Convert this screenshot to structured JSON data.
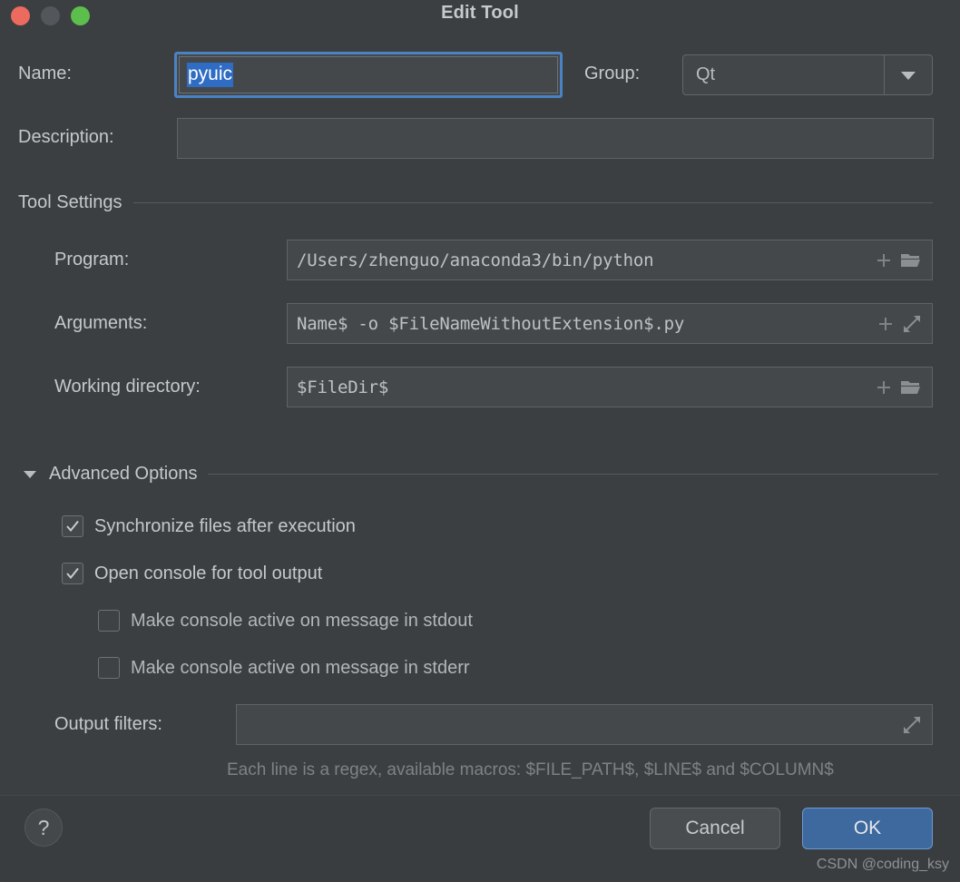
{
  "window": {
    "title": "Edit Tool",
    "traffic_lights": [
      {
        "name": "close",
        "color": "#ec6a5e"
      },
      {
        "name": "minimize",
        "color": "#53575b"
      },
      {
        "name": "zoom",
        "color": "#5cbe4d"
      }
    ]
  },
  "form": {
    "name_label": "Name:",
    "name_value": "pyuic",
    "group_label": "Group:",
    "group_value": "Qt",
    "description_label": "Description:",
    "description_value": "",
    "description_placeholder": ""
  },
  "tool_settings": {
    "section_title": "Tool Settings",
    "program_label": "Program:",
    "program_value": "/Users/zhenguo/anaconda3/bin/python",
    "arguments_label": "Arguments:",
    "arguments_value": "Name$ -o $FileNameWithoutExtension$.py",
    "working_directory_label": "Working directory:",
    "working_directory_value": "$FileDir$"
  },
  "advanced": {
    "section_title": "Advanced Options",
    "checkboxes": [
      {
        "label": "Synchronize files after execution",
        "checked": true,
        "indent": 0
      },
      {
        "label": "Open console for tool output",
        "checked": true,
        "indent": 0
      },
      {
        "label": "Make console active on message in stdout",
        "checked": false,
        "indent": 1
      },
      {
        "label": "Make console active on message in stderr",
        "checked": false,
        "indent": 1
      }
    ],
    "output_filters_label": "Output filters:",
    "output_filters_value": "",
    "hint": "Each line is a regex, available macros: $FILE_PATH$, $LINE$ and $COLUMN$"
  },
  "footer": {
    "help_label": "?",
    "cancel_label": "Cancel",
    "ok_label": "OK",
    "watermark": "CSDN @coding_ksy",
    "ok_color": "#3d699f"
  },
  "icons": {
    "plus": "plus-icon",
    "folder": "folder-icon",
    "expand": "expand-icon",
    "chevron_down": "chevron-down-icon"
  }
}
